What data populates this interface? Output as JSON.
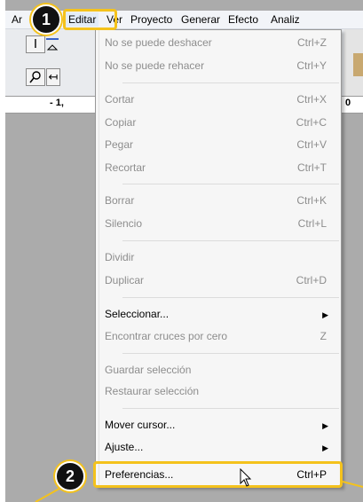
{
  "menubar": {
    "items": [
      {
        "label": "Ar"
      },
      {
        "label": "Editar"
      },
      {
        "label": "Ver"
      },
      {
        "label": "Proyecto"
      },
      {
        "label": "Generar"
      },
      {
        "label": "Efecto"
      },
      {
        "label": "Analiz"
      }
    ]
  },
  "ruler": {
    "left_label": "- 1,",
    "right_label": "0"
  },
  "toolbar": {
    "select_tool_icon": "text-cursor-icon",
    "zoom_tool_icon": "magnifier-icon",
    "timeshift_tool_icon": "arrow-icon"
  },
  "edit_menu": {
    "items": [
      {
        "label": "No se puede deshacer",
        "shortcut": "Ctrl+Z"
      },
      {
        "label": "No se puede rehacer",
        "shortcut": "Ctrl+Y"
      },
      {
        "label": "Cortar",
        "shortcut": "Ctrl+X"
      },
      {
        "label": "Copiar",
        "shortcut": "Ctrl+C"
      },
      {
        "label": "Pegar",
        "shortcut": "Ctrl+V"
      },
      {
        "label": "Recortar",
        "shortcut": "Ctrl+T"
      },
      {
        "label": "Borrar",
        "shortcut": "Ctrl+K"
      },
      {
        "label": "Silencio",
        "shortcut": "Ctrl+L"
      },
      {
        "label": "Dividir",
        "shortcut": ""
      },
      {
        "label": "Duplicar",
        "shortcut": "Ctrl+D"
      },
      {
        "label": "Seleccionar...",
        "shortcut": ""
      },
      {
        "label": "Encontrar cruces por cero",
        "shortcut": "Z"
      },
      {
        "label": "Guardar selección",
        "shortcut": ""
      },
      {
        "label": "Restaurar selección",
        "shortcut": ""
      },
      {
        "label": "Mover cursor...",
        "shortcut": ""
      },
      {
        "label": "Ajuste...",
        "shortcut": ""
      },
      {
        "label": "Preferencias...",
        "shortcut": "Ctrl+P"
      }
    ]
  },
  "annotations": {
    "step1": "1",
    "step2": "2",
    "highlight_color": "#f4c21c"
  }
}
